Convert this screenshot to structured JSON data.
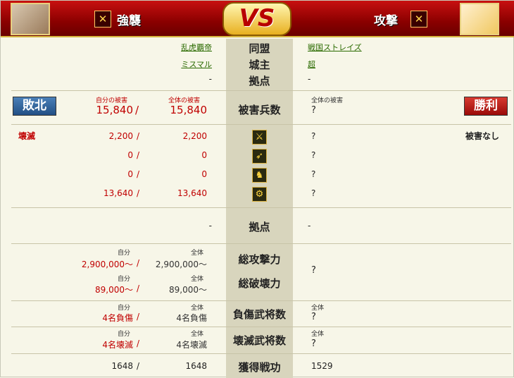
{
  "header": {
    "left_title": "強襲",
    "right_title": "攻撃",
    "vs": "VS",
    "left_icon": "crossed-flag-icon",
    "right_icon": "crossed-swords-icon"
  },
  "rows": {
    "alliance": {
      "label": "同盟",
      "left": "乱虎覇帝",
      "right": "戦国ストレイズ"
    },
    "lord": {
      "label": "城主",
      "left": "ミスマル",
      "right": "超"
    },
    "base": {
      "label": "拠点",
      "left": "-",
      "right": "-"
    }
  },
  "result": {
    "left": "敗北",
    "right": "勝利",
    "left_color": "#2a5c95",
    "right_color": "#b81010"
  },
  "damage": {
    "label": "被害兵数",
    "own_caption": "自分の被害",
    "all_caption": "全体の被害",
    "own_total": "15,840",
    "all_total": "15,840",
    "right_caption": "全体の被害",
    "right_value": "?",
    "left_status": "壊滅",
    "right_status": "被害なし",
    "units": [
      {
        "icon": "spearman-icon",
        "own": "2,200",
        "all": "2,200",
        "right": "?"
      },
      {
        "icon": "archer-icon",
        "own": "0",
        "all": "0",
        "right": "?"
      },
      {
        "icon": "cavalry-icon",
        "own": "0",
        "all": "0",
        "right": "?"
      },
      {
        "icon": "siege-icon",
        "own": "13,640",
        "all": "13,640",
        "right": "?"
      }
    ]
  },
  "base2": {
    "label": "拠点",
    "left": "-",
    "right": "-"
  },
  "power": {
    "attack_label": "総攻撃力",
    "destroy_label": "総破壊力",
    "own_caption": "自分",
    "all_caption": "全体",
    "attack_own": "2,900,000～",
    "attack_all": "2,900,000～",
    "destroy_own": "89,000～",
    "destroy_all": "89,000～",
    "right_value": "?"
  },
  "wounded": {
    "label": "負傷武将数",
    "own_caption": "自分",
    "all_caption": "全体",
    "own": "4名負傷",
    "all": "4名負傷",
    "right_caption": "全体",
    "right": "?"
  },
  "destroyed": {
    "label": "壊滅武将数",
    "own_caption": "自分",
    "all_caption": "全体",
    "own": "4名壊滅",
    "all": "4名壊滅",
    "right_caption": "全体",
    "right": "?"
  },
  "merit": {
    "label": "獲得戦功",
    "own": "1648",
    "all": "1648",
    "right": "1529"
  },
  "slash": "/"
}
